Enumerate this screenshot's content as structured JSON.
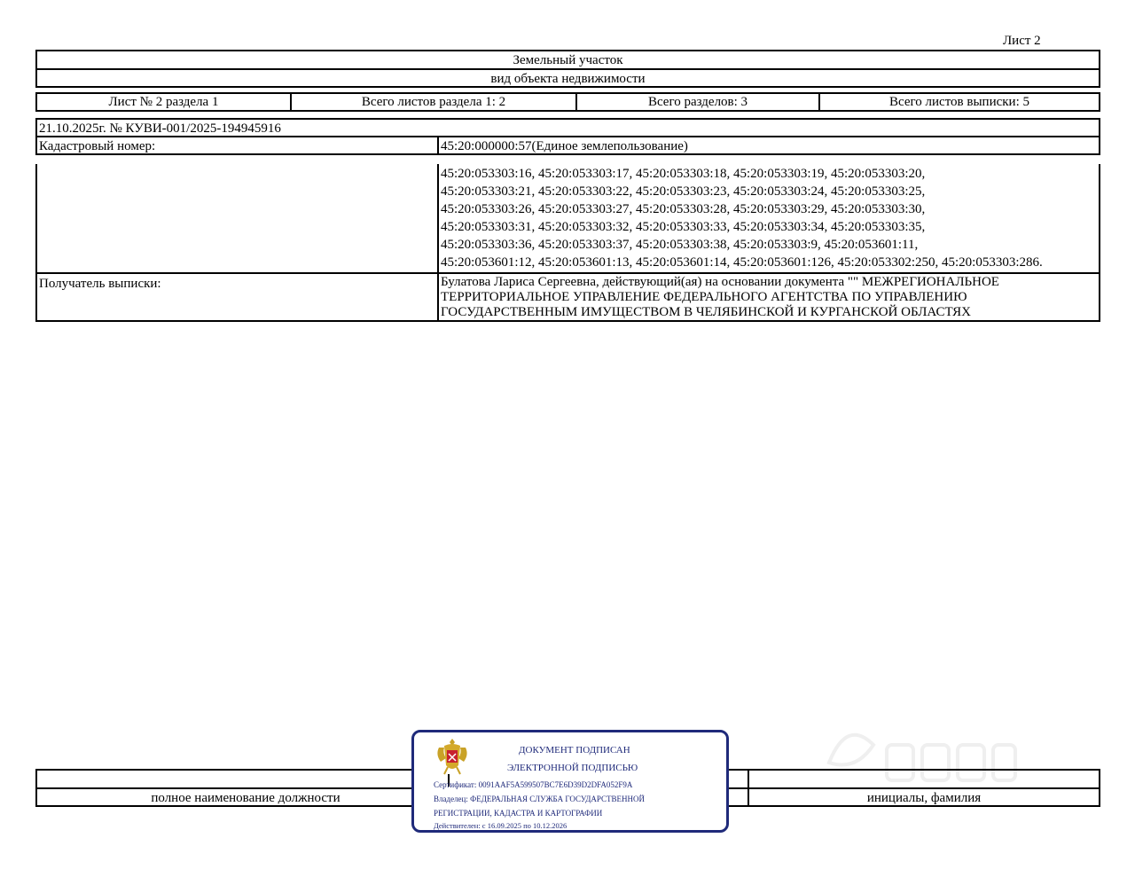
{
  "sheet_label": "Лист 2",
  "header": {
    "object_title": "Земельный участок",
    "object_subtitle": "вид объекта недвижимости"
  },
  "info_row": {
    "sheet_of_section": "Лист № 2 раздела 1",
    "total_section_sheets": "Всего листов раздела 1: 2",
    "total_sections": "Всего разделов: 3",
    "total_sheets": "Всего листов выписки: 5"
  },
  "document": {
    "date_number": "21.10.2025г. № КУВИ-001/2025-194945916",
    "cadastral_label": "Кадастровый номер:",
    "cadastral_value": "45:20:000000:57(Единое землепользование)"
  },
  "cadastral_list_lines": [
    "45:20:053303:16, 45:20:053303:17, 45:20:053303:18, 45:20:053303:19, 45:20:053303:20,",
    "45:20:053303:21, 45:20:053303:22, 45:20:053303:23, 45:20:053303:24, 45:20:053303:25,",
    "45:20:053303:26, 45:20:053303:27, 45:20:053303:28, 45:20:053303:29, 45:20:053303:30,",
    "45:20:053303:31, 45:20:053303:32, 45:20:053303:33, 45:20:053303:34, 45:20:053303:35,",
    "45:20:053303:36, 45:20:053303:37, 45:20:053303:38, 45:20:053303:9, 45:20:053601:11,",
    "45:20:053601:12, 45:20:053601:13, 45:20:053601:14, 45:20:053601:126, 45:20:053302:250, 45:20:053303:286."
  ],
  "recipient": {
    "label": "Получатель выписки:",
    "lines": [
      "Булатова Лариса Сергеевна, действующий(ая) на основании документа \"\" МЕЖРЕГИОНАЛЬНОЕ",
      "ТЕРРИТОРИАЛЬНОЕ УПРАВЛЕНИЕ ФЕДЕРАЛЬНОГО АГЕНТСТВА ПО УПРАВЛЕНИЮ",
      "ГОСУДАРСТВЕННЫМ ИМУЩЕСТВОМ В ЧЕЛЯБИНСКОЙ И КУРГАНСКОЙ ОБЛАСТЯХ"
    ]
  },
  "footer": {
    "position_label": "полное наименование должности",
    "name_label": "инициалы, фамилия"
  },
  "stamp": {
    "line1": "ДОКУМЕНТ ПОДПИСАН",
    "line2": "ЭЛЕКТРОННОЙ ПОДПИСЬЮ",
    "certificate": "Сертификат: 0091AAF5A599507BC7E6D39D2DFA052F9A",
    "owner_line1": "Владелец: ФЕДЕРАЛЬНАЯ СЛУЖБА ГОСУДАРСТВЕННОЙ",
    "owner_line2": "РЕГИСТРАЦИИ, КАДАСТРА И КАРТОГРАФИИ",
    "validity": "Действителен: с 16.09.2025 по 10.12.2026",
    "border_color": "#1f2a7a",
    "emblem_icon": "russian-coat-of-arms-icon"
  }
}
